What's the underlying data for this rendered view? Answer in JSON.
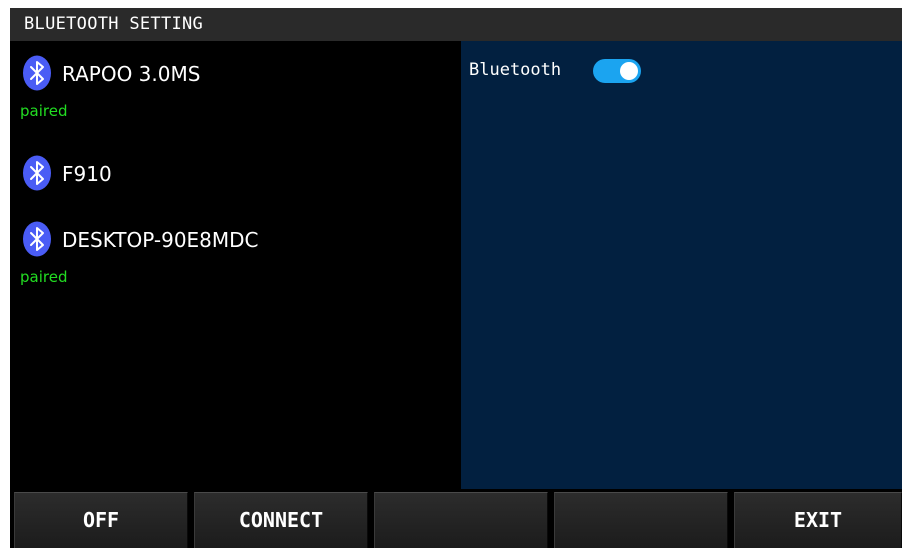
{
  "window": {
    "title": "BLUETOOTH SETTING"
  },
  "colors": {
    "title_bar": "#2a2a2a",
    "device_panel": "#000000",
    "settings_panel": "#022040",
    "bluetooth_icon": "#4a5cf5",
    "paired_status": "#22dd22",
    "toggle_on": "#1ba4f0"
  },
  "devices": [
    {
      "name": "RAPOO 3.0MS",
      "status": "paired",
      "icon": "bluetooth-icon"
    },
    {
      "name": "F910",
      "status": "",
      "icon": "bluetooth-icon"
    },
    {
      "name": "DESKTOP-90E8MDC",
      "status": "paired",
      "icon": "bluetooth-icon"
    }
  ],
  "settings": {
    "bluetooth_label": "Bluetooth",
    "bluetooth_enabled": true
  },
  "buttons": [
    {
      "label": "OFF"
    },
    {
      "label": "CONNECT"
    },
    {
      "label": ""
    },
    {
      "label": ""
    },
    {
      "label": "EXIT"
    }
  ]
}
